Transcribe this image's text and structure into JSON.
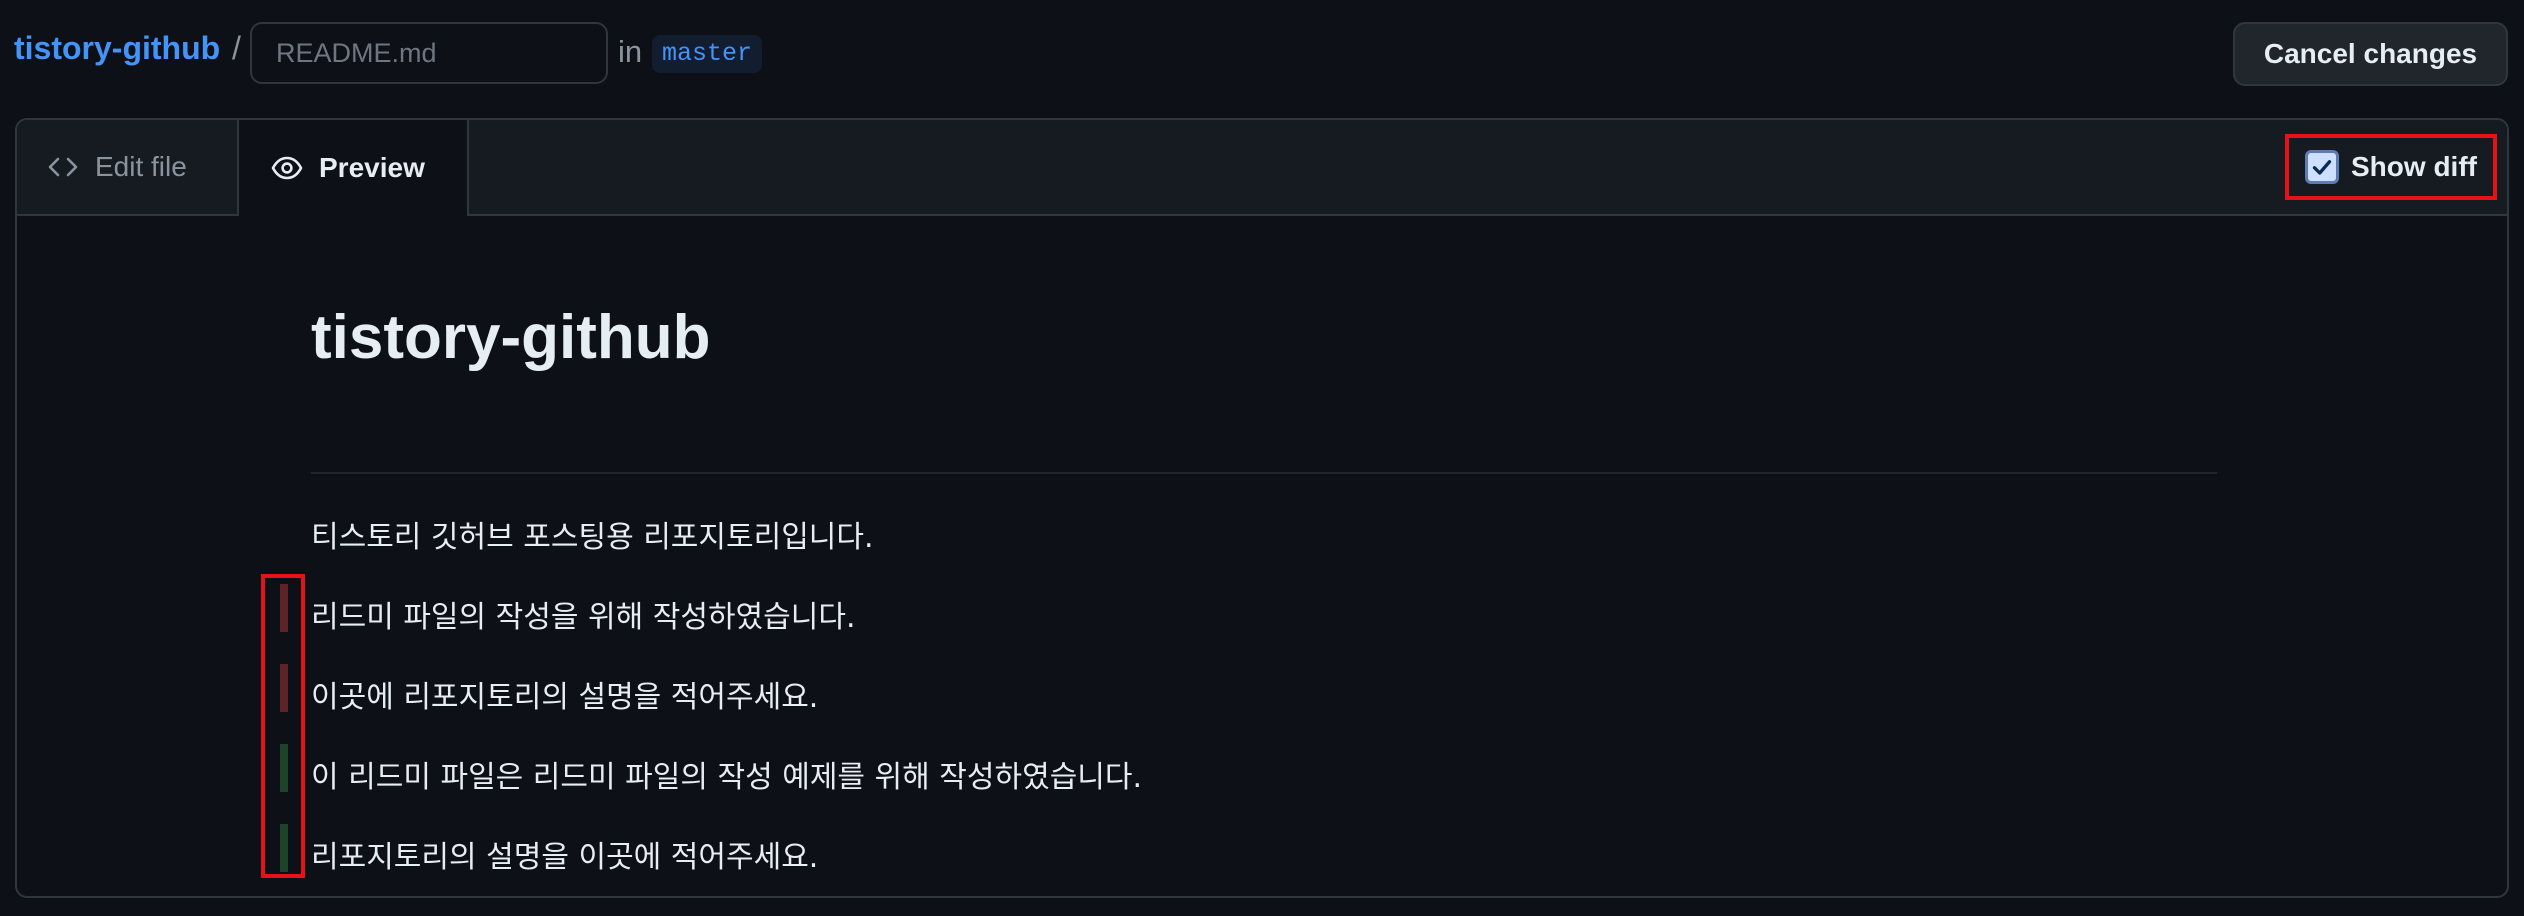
{
  "header": {
    "repo_name": "tistory-github",
    "separator": "/",
    "filename_placeholder": "README.md",
    "in_label": "in",
    "branch": "master",
    "cancel_label": "Cancel changes"
  },
  "tabs": [
    {
      "label": "Edit file",
      "icon": "code-icon",
      "active": false
    },
    {
      "label": "Preview",
      "icon": "eye-icon",
      "active": true
    }
  ],
  "show_diff": {
    "label": "Show diff",
    "checked": true
  },
  "preview": {
    "title": "tistory-github",
    "lines": [
      {
        "text": "티스토리 깃허브 포스팅용 리포지토리입니다.",
        "diff": "none"
      },
      {
        "text": "리드미 파일의 작성을 위해 작성하였습니다.",
        "diff": "removed"
      },
      {
        "text": "이곳에 리포지토리의 설명을 적어주세요.",
        "diff": "removed"
      },
      {
        "text": "이 리드미 파일은 리드미 파일의 작성 예제를 위해 작성하였습니다.",
        "diff": "added"
      },
      {
        "text": "리포지토리의 설명을 이곳에 적어주세요.",
        "diff": "added"
      }
    ]
  },
  "colors": {
    "background": "#0d1117",
    "link": "#4493f8",
    "diff_removed": "#5c2427",
    "diff_added": "#1d4428",
    "highlight": "#e5121a"
  }
}
